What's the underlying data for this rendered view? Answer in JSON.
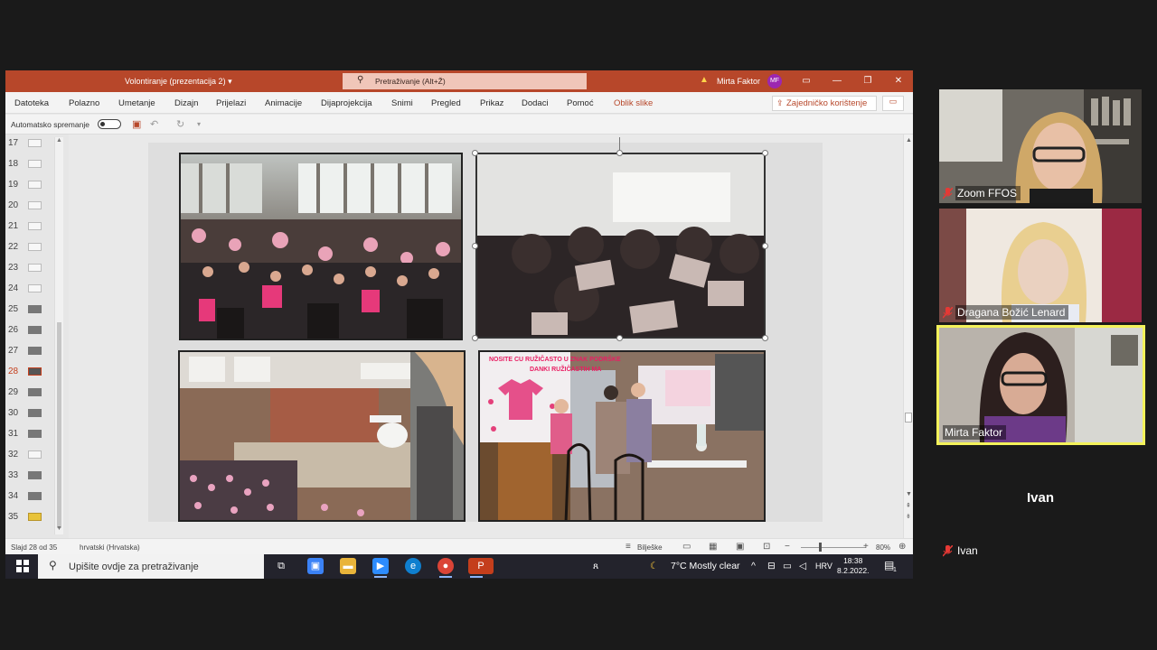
{
  "ppt": {
    "doc_title": "Volontiranje (prezentacija 2) ▾",
    "search_placeholder": "Pretraživanje (Alt+Ž)",
    "user_name": "Mirta Faktor",
    "user_initials": "MF",
    "menu": [
      "Datoteka",
      "Polazno",
      "Umetanje",
      "Dizajn",
      "Prijelazi",
      "Animacije",
      "Dijaprojekcija",
      "Snimi",
      "Pregled",
      "Prikaz",
      "Dodaci",
      "Pomoć"
    ],
    "contextual_tab": "Oblik slike",
    "share_label": "Zajedničko korištenje",
    "autosave_label": "Automatsko spremanje",
    "autosave_on": false,
    "slide_numbers": [
      "17",
      "18",
      "19",
      "20",
      "21",
      "22",
      "23",
      "24",
      "25",
      "26",
      "27",
      "28",
      "29",
      "30",
      "31",
      "32",
      "33",
      "34",
      "35"
    ],
    "selected_slide": "28",
    "slide_captions": [
      "NOSITE CU RUŽIČASTO U ZNAK PODRŠKE",
      "DANKI RUŽIČASTIH MA"
    ],
    "status": {
      "slide_of": "Slajd 28 od 35",
      "language": "hrvatski (Hrvatska)",
      "notes": "Bilješke",
      "zoom": "80%"
    }
  },
  "taskbar": {
    "search_placeholder": "Upišite ovdje za pretraživanje",
    "weather": "7°C  Mostly clear",
    "lang": "HRV",
    "time": "18:38",
    "date": "8.2.2022.",
    "notif_count": "1"
  },
  "zoom": {
    "participants": [
      {
        "name": "Zoom FFOS",
        "muted": true,
        "active": false
      },
      {
        "name": "Dragana Božić Lenard",
        "muted": true,
        "active": false
      },
      {
        "name": "Mirta Faktor",
        "muted": false,
        "active": true
      },
      {
        "name": "Ivan",
        "muted": true,
        "active": false,
        "video_off": true
      }
    ]
  },
  "colors": {
    "ppt_accent": "#b7472a",
    "active_speaker": "#f4f25a",
    "mute_red": "#e53935"
  }
}
